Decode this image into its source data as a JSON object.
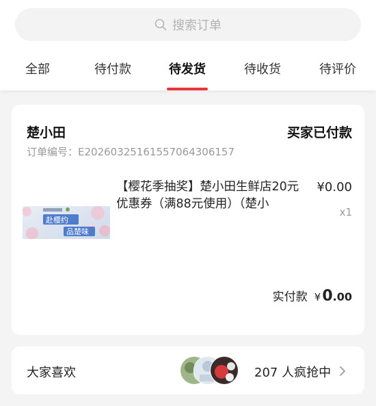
{
  "search": {
    "placeholder": "搜索订单"
  },
  "tabs": [
    {
      "label": "全部",
      "active": false
    },
    {
      "label": "待付款",
      "active": false
    },
    {
      "label": "待发货",
      "active": true
    },
    {
      "label": "待收货",
      "active": false
    },
    {
      "label": "待评价",
      "active": false
    }
  ],
  "colors": {
    "accent": "#e8363f",
    "muted": "#999999",
    "background": "#f4f4f4"
  },
  "order": {
    "shop_name": "楚小田",
    "status": "买家已付款",
    "order_no_label": "订单编号：",
    "order_no": "E20260325161557064306157",
    "product": {
      "title": "【樱花季抽奖】楚小田生鲜店20元优惠券（满88元使用）（楚小",
      "price": "¥0.00",
      "quantity": "x1",
      "image_text_1": "赴樱约",
      "image_text_2": "品楚味"
    },
    "paid_label": "实付款",
    "paid_currency": "¥",
    "paid_int": "0",
    "paid_dec": ".00"
  },
  "recommend": {
    "label": "大家喜欢",
    "count_text": "207 人疯抢中"
  }
}
